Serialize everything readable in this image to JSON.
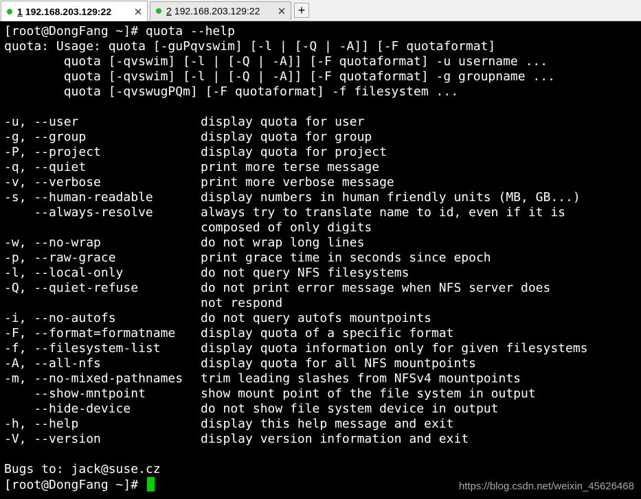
{
  "tabs": [
    {
      "number": "1",
      "title": "192.168.203.129:22",
      "active": true
    },
    {
      "number": "2",
      "title": "192.168.203.129:22",
      "active": false
    }
  ],
  "new_tab_label": "+",
  "terminal": {
    "command_line": "[root@DongFang ~]# quota --help",
    "usage": [
      "quota: Usage: quota [-guPqvswim] [-l | [-Q | -A]] [-F quotaformat]",
      "        quota [-qvswim] [-l | [-Q | -A]] [-F quotaformat] -u username ...",
      "        quota [-qvswim] [-l | [-Q | -A]] [-F quotaformat] -g groupname ...",
      "        quota [-qvswugPQm] [-F quotaformat] -f filesystem ..."
    ],
    "options": [
      {
        "flag": "-u, --user",
        "desc": "display quota for user"
      },
      {
        "flag": "-g, --group",
        "desc": "display quota for group"
      },
      {
        "flag": "-P, --project",
        "desc": "display quota for project"
      },
      {
        "flag": "-q, --quiet",
        "desc": "print more terse message"
      },
      {
        "flag": "-v, --verbose",
        "desc": "print more verbose message"
      },
      {
        "flag": "-s, --human-readable",
        "desc": "display numbers in human friendly units (MB, GB...)"
      },
      {
        "flag": "    --always-resolve",
        "desc": "always try to translate name to id, even if it is"
      },
      {
        "flag": "",
        "desc": "composed of only digits"
      },
      {
        "flag": "-w, --no-wrap",
        "desc": "do not wrap long lines"
      },
      {
        "flag": "-p, --raw-grace",
        "desc": "print grace time in seconds since epoch"
      },
      {
        "flag": "-l, --local-only",
        "desc": "do not query NFS filesystems"
      },
      {
        "flag": "-Q, --quiet-refuse",
        "desc": "do not print error message when NFS server does"
      },
      {
        "flag": "",
        "desc": "not respond"
      },
      {
        "flag": "-i, --no-autofs",
        "desc": "do not query autofs mountpoints"
      },
      {
        "flag": "-F, --format=formatname",
        "desc": "display quota of a specific format"
      },
      {
        "flag": "-f, --filesystem-list",
        "desc": "display quota information only for given filesystems"
      },
      {
        "flag": "-A, --all-nfs",
        "desc": "display quota for all NFS mountpoints"
      },
      {
        "flag": "-m, --no-mixed-pathnames",
        "desc": "trim leading slashes from NFSv4 mountpoints"
      },
      {
        "flag": "    --show-mntpoint",
        "desc": "show mount point of the file system in output"
      },
      {
        "flag": "    --hide-device",
        "desc": "do not show file system device in output"
      },
      {
        "flag": "-h, --help",
        "desc": "display this help message and exit"
      },
      {
        "flag": "-V, --version",
        "desc": "display version information and exit"
      }
    ],
    "bugs_line": "Bugs to: jack@suse.cz",
    "prompt": "[root@DongFang ~]#"
  },
  "watermark": "https://blog.csdn.net/weixin_45626468",
  "colors": {
    "background": "#000000",
    "text": "#ffffff",
    "cursor": "#00d000",
    "status_dot": "#1db91d"
  }
}
